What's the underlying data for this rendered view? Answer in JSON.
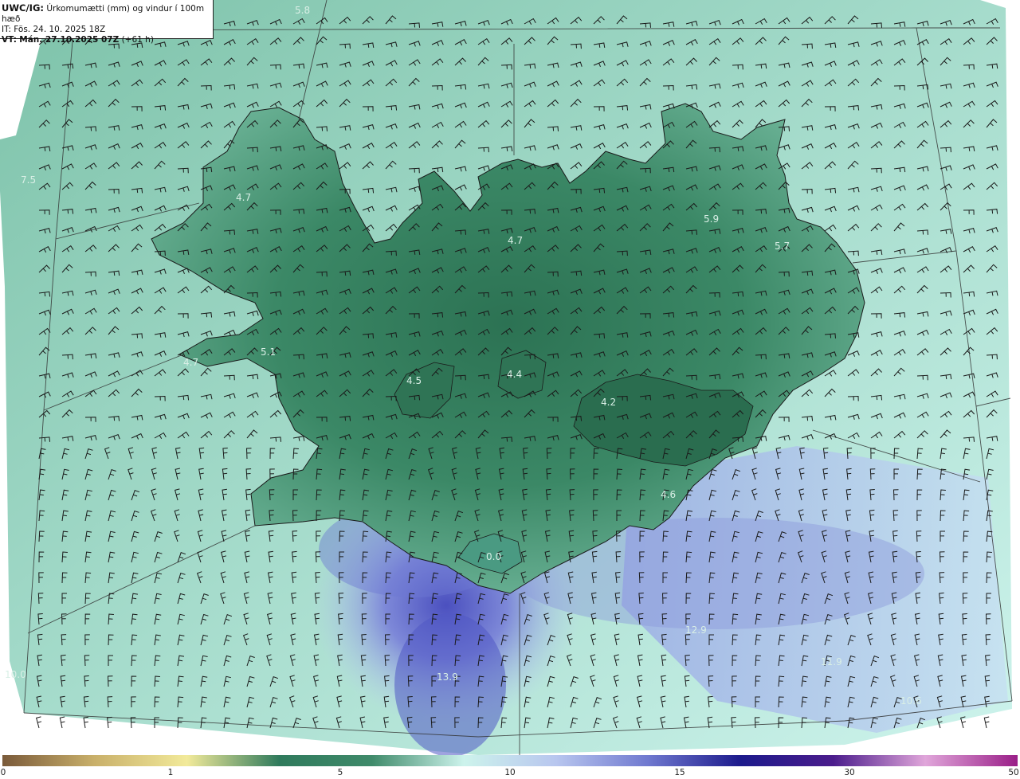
{
  "info": {
    "product": "UWC/IG:",
    "title": "Úrkomumætti (mm) og vindur í 100m hæð",
    "it": "IT: Fös. 24. 10. 2025 18Z",
    "vt_prefix": "VT:",
    "vt_bold": "Mán. 27.10.2025 07Z",
    "vt_suffix": "(+61 h)"
  },
  "colorbar": {
    "ticks": [
      {
        "label": "0",
        "value": 0
      },
      {
        "label": "1",
        "value": 1
      },
      {
        "label": "5",
        "value": 5
      },
      {
        "label": "10",
        "value": 10
      },
      {
        "label": "15",
        "value": 15
      },
      {
        "label": "30",
        "value": 30
      },
      {
        "label": "50",
        "value": 50
      }
    ],
    "stops": [
      "#7a5a3a",
      "#c9b06a",
      "#f2ea9a",
      "#2f7a5c",
      "#3f8a6a",
      "#cdf3ec",
      "#b8c6ef",
      "#6f78cf",
      "#1c1a8c",
      "#4b1c8c",
      "#e0a6da",
      "#9a1f88"
    ]
  },
  "colors": {
    "land_dark": "#2e7556",
    "sea_light": "#cdf3ec",
    "heavy_precip": "#5d66c9",
    "coast": "#1a1a1a"
  },
  "value_labels": [
    "5.8",
    "7.5",
    "4.7",
    "4.7",
    "5.9",
    "5.7",
    "5.1",
    "4.7",
    "4.5",
    "4.4",
    "4.2",
    "4.6",
    "0.0",
    "12.9",
    "13.9",
    "11.9",
    "10.6",
    "10.0"
  ]
}
